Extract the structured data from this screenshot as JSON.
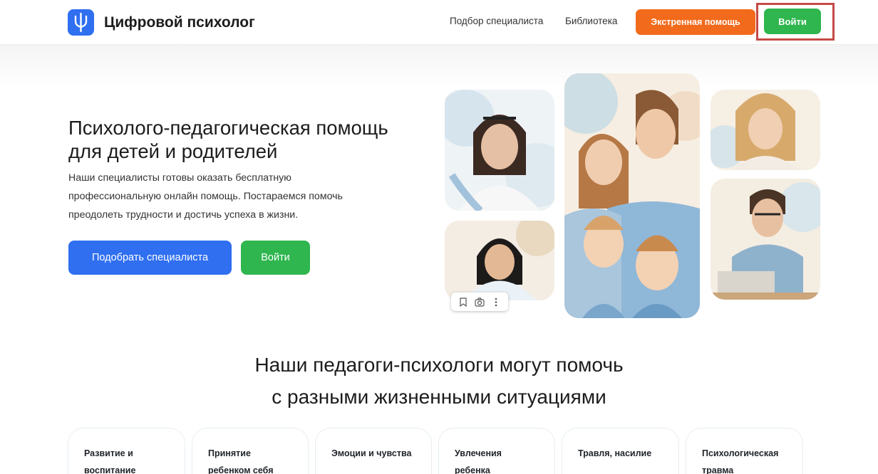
{
  "header": {
    "logo_text": "Цифровой психолог",
    "nav": [
      "Подбор специалиста",
      "Библиотека"
    ],
    "emergency_label": "Экстренная помощь",
    "login_label": "Войти"
  },
  "hero": {
    "title": "Психолого-педагогическая помощь для детей и родителей",
    "description": "Наши специалисты готовы оказать бесплатную профессиональную онлайн помощь. Постараемся помочь преодолеть трудности и достичь успеха в жизни.",
    "pick_label": "Подобрать специалиста",
    "login_label": "Войти"
  },
  "section": {
    "title_line1": "Наши педагоги-психологи могут помочь",
    "title_line2": "с разными жизненными ситуациями"
  },
  "cards": [
    {
      "label": "Развитие и воспитание"
    },
    {
      "label": "Принятие ребенком себя"
    },
    {
      "label": "Эмоции и чувства"
    },
    {
      "label": "Увлечения ребенка"
    },
    {
      "label": "Травля, насилие"
    },
    {
      "label": "Психологическая травма"
    }
  ],
  "colors": {
    "brand_blue": "#2f6ff0",
    "green": "#2fb64e",
    "orange": "#f26a1b",
    "highlight": "#c54a46"
  }
}
